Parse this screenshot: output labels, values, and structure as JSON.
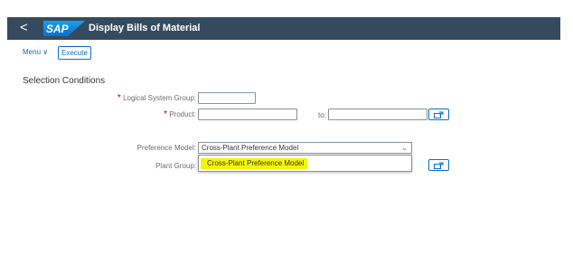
{
  "shell": {
    "back_glyph": "<",
    "logo_text": "SAP",
    "app_title": "Display Bills of Material"
  },
  "toolbar": {
    "menu_label": "Menu",
    "menu_chevron": "∨",
    "execute_label": "Execute"
  },
  "section": {
    "title": "Selection Conditions"
  },
  "fields": {
    "required_marker": "*",
    "logical_system_group_label": "Logical System Group:",
    "logical_system_group_value": "",
    "product_label": "Product:",
    "product_from_value": "",
    "to_label": "to:",
    "product_to_value": "",
    "preference_model_label": "Preference Model:",
    "preference_model_value": "Cross-Plant Preference Model",
    "plant_group_label": "Plant Group:"
  },
  "dropdown": {
    "options": [
      "Cross-Plant Preference Model"
    ],
    "highlight_color": "#f5f500"
  },
  "icons": {
    "back": "chevron-left-icon",
    "value_help": "value-help-icon",
    "select_arrow": "chevron-down-icon"
  },
  "colors": {
    "shell_bg": "#354a5f",
    "accent": "#0a6ed1",
    "required": "#bb0000"
  }
}
